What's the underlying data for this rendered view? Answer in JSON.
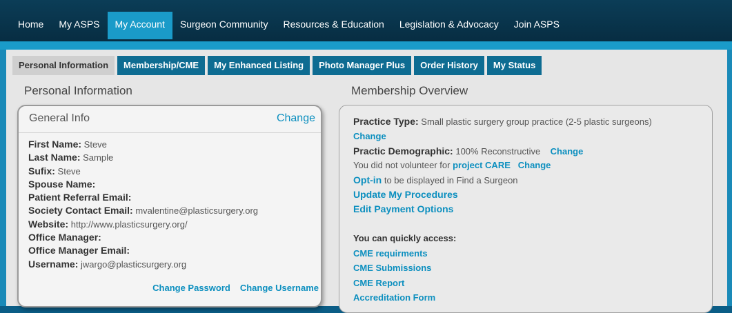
{
  "nav": {
    "items": [
      "Home",
      "My ASPS",
      "My Account",
      "Surgeon Community",
      "Resources & Education",
      "Legislation & Advocacy",
      "Join ASPS"
    ],
    "active": "My Account"
  },
  "tabs": {
    "items": [
      "Personal Information",
      "Membership/CME",
      "My Enhanced Listing",
      "Photo Manager Plus",
      "Order History",
      "My Status"
    ],
    "active": "Personal Information"
  },
  "personal": {
    "section_title": "Personal Information",
    "card_title": "General Info",
    "change_label": "Change",
    "fields": [
      {
        "label": "First Name",
        "value": "Steve"
      },
      {
        "label": "Last Name",
        "value": "Sample"
      },
      {
        "label": "Sufix",
        "value": "Steve"
      },
      {
        "label": "Spouse Name",
        "value": ""
      },
      {
        "label": "Patient Referral Email",
        "value": ""
      },
      {
        "label": "Society Contact Email",
        "value": "mvalentine@plasticsurgery.org"
      },
      {
        "label": "Website",
        "value": "http://www.plasticsurgery.org/"
      },
      {
        "label": "Office Manager",
        "value": ""
      },
      {
        "label": "Office Manager Email",
        "value": ""
      },
      {
        "label": "Username",
        "value": "jwargo@plasticsurgery.org"
      }
    ],
    "change_password": "Change Password",
    "change_username": "Change Username"
  },
  "membership": {
    "section_title": "Membership Overview",
    "practice_type_label": "Practice Type:",
    "practice_type_value": "Small plastic surgery group practice (2-5 plastic surgeons)",
    "change": "Change",
    "demographic_label": "Practic Demographic:",
    "demographic_value": "100% Reconstructive",
    "volunteer_text": "You did not volunteer for",
    "project_care": "project CARE",
    "optin_link": "Opt-in",
    "optin_text": "to be displayed in Find a Surgeon",
    "update_procedures": "Update My Procedures",
    "edit_payment": "Edit Payment Options",
    "quick_access": "You can quickly access:",
    "quick_links": [
      "CME requirments",
      "CME Submissions",
      "CME Report",
      "Accreditation Form"
    ]
  }
}
